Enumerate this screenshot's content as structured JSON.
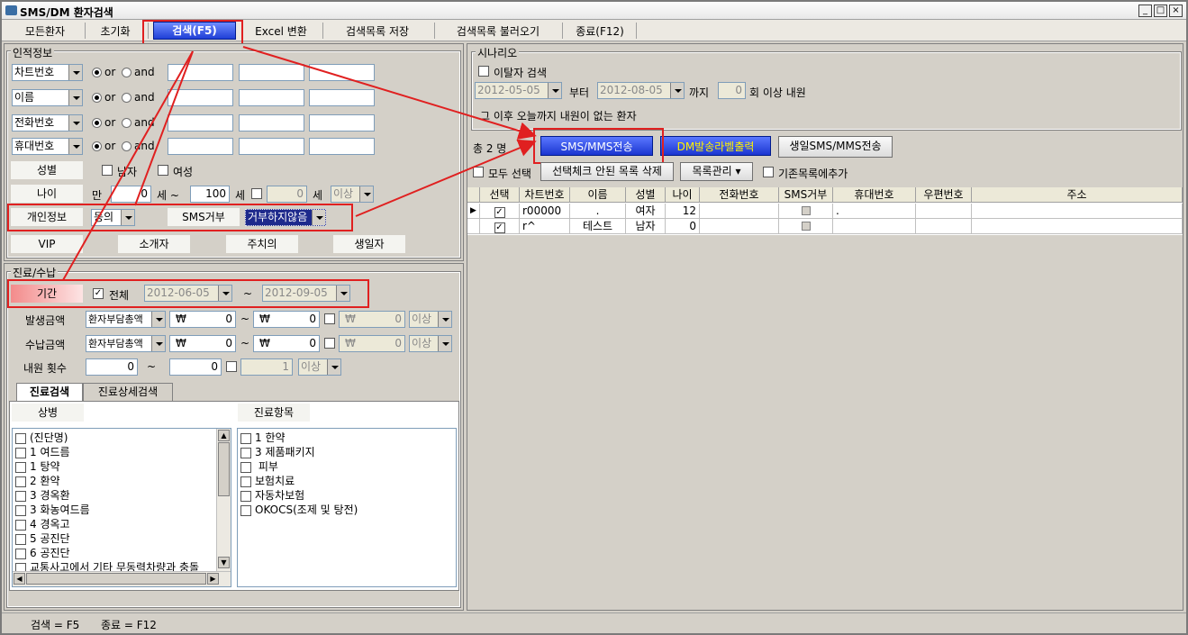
{
  "window": {
    "title": "SMS/DM 환자검색"
  },
  "menu": {
    "all_patients": "모든환자",
    "reset": "초기화",
    "search": "검색(F5)",
    "excel": "Excel 변환",
    "save_list": "검색목록 저장",
    "load_list": "검색목록 불러오기",
    "exit": "종료(F12)"
  },
  "personal": {
    "legend": "인적정보",
    "rows": [
      {
        "field": "차트번호",
        "or": "or",
        "and": "and"
      },
      {
        "field": "이름",
        "or": "or",
        "and": "and"
      },
      {
        "field": "전화번호",
        "or": "or",
        "and": "and"
      },
      {
        "field": "휴대번호",
        "or": "or",
        "and": "and"
      }
    ],
    "gender_label": "성별",
    "male": "남자",
    "female": "여성",
    "age_label": "나이",
    "age_prefix": "만",
    "age_from": "0",
    "age_unit1": "세 ~",
    "age_to": "100",
    "age_unit2": "세",
    "age_extra": "0",
    "age_unit3": "세",
    "age_cond": "이상",
    "privacy_label": "개인정보",
    "privacy_value": "동의",
    "sms_refuse_label": "SMS거부",
    "sms_refuse_value": "거부하지않음",
    "vip": "VIP",
    "referrer": "소개자",
    "caution": "주치의",
    "birthday": "생일자"
  },
  "treatment": {
    "legend": "진료/수납",
    "period_label": "기간",
    "all_label": "전체",
    "date_from": "2012-06-05",
    "tilde": "~",
    "date_to": "2012-09-05",
    "amount_rows": [
      {
        "label": "발생금액",
        "type": "환자부담총액",
        "cur": "₩",
        "from": "0",
        "to": "0",
        "extra": "0",
        "cond": "이상"
      },
      {
        "label": "수납금액",
        "type": "환자부담총액",
        "cur": "₩",
        "from": "0",
        "to": "0",
        "extra": "0",
        "cond": "이상"
      }
    ],
    "visit_label": "내원 횟수",
    "visit_from": "0",
    "visit_to": "0",
    "visit_extra": "1",
    "visit_cond": "이상",
    "tabs": [
      "진료검색",
      "진료상세검색"
    ],
    "disease_header": "상병",
    "item_header": "진료항목",
    "diseases": [
      "(진단명)",
      "1        여드름",
      "1 탕약",
      "2 환약",
      "3 경옥환",
      "3 화농여드름",
      "4 경옥고",
      "5 공진단",
      "6 공진단",
      "교통사고에서 기타 무동력차량과 충돌"
    ],
    "items": [
      "1 한약",
      "3 제품패키지",
      "        피부",
      "보험치료",
      "자동차보험",
      "OKOCS(조제 및 탕전)"
    ]
  },
  "scenario": {
    "legend": "시나리오",
    "dropout_label": "이탈자 검색",
    "from_date": "2012-05-05",
    "from_word": "부터",
    "to_date": "2012-08-05",
    "to_word": "까지",
    "count": "0",
    "count_suffix": "회 이상 내원",
    "no_visit": "그 이후 오늘까지 내원이 없는 환자"
  },
  "results": {
    "total": "총 2 명",
    "sms_button": "SMS/MMS전송",
    "dm_button": "DM발송라벨출력",
    "birthday_button": "생일SMS/MMS전송",
    "select_all": "모두 선택",
    "delete_unchecked": "선택체크 안된 목록 삭제",
    "list_manage": "목록관리",
    "add_existing": "기존목록에추가",
    "columns": [
      "선택",
      "차트번호",
      "이름",
      "성별",
      "나이",
      "전화번호",
      "SMS거부",
      "휴대번호",
      "우편번호",
      "주소"
    ],
    "rows": [
      {
        "chart": "r00000",
        "name": ".",
        "gender": "여자",
        "age": "12",
        "phone": "",
        "mobile": ".",
        "zip": "",
        "addr": ""
      },
      {
        "chart": "r^",
        "name": "테스트",
        "gender": "남자",
        "age": "0",
        "phone": "",
        "mobile": "",
        "zip": "",
        "addr": ""
      }
    ]
  },
  "status": {
    "search": "검색 = F5",
    "exit": "종료 = F12"
  }
}
